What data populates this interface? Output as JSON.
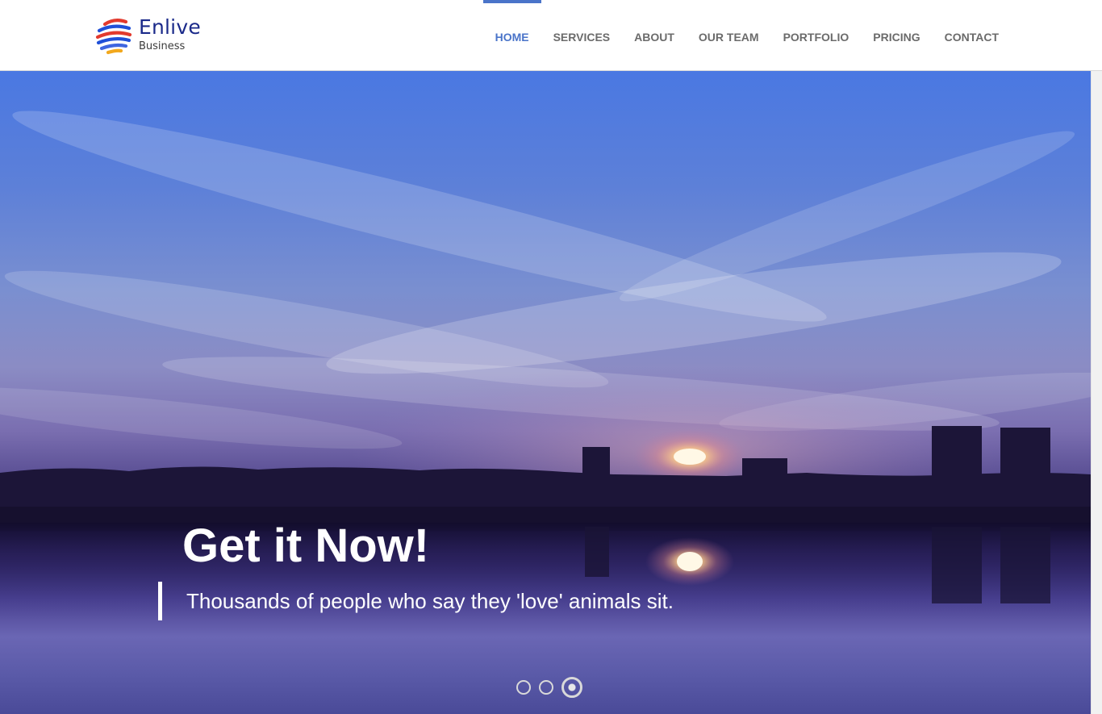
{
  "brand": {
    "name": "Enlive",
    "tagline": "Business",
    "logo_icon": "striped-globe-icon",
    "colors": {
      "primary": "#1b2a8a",
      "accent": "#4a74c9",
      "ring_red": "#e23a2e",
      "ring_blue": "#2050d8"
    }
  },
  "nav": {
    "items": [
      {
        "label": "HOME",
        "active": true
      },
      {
        "label": "SERVICES",
        "active": false
      },
      {
        "label": "ABOUT",
        "active": false
      },
      {
        "label": "OUR TEAM",
        "active": false
      },
      {
        "label": "PORTFOLIO",
        "active": false
      },
      {
        "label": "PRICING",
        "active": false
      },
      {
        "label": "CONTACT",
        "active": false
      }
    ]
  },
  "hero": {
    "image": "sunset-over-lake-with-city-silhouette",
    "title": "Get it Now!",
    "quote": "Thousands of people who say they 'love' animals sit.",
    "slides_total": 3,
    "active_slide": 3
  }
}
